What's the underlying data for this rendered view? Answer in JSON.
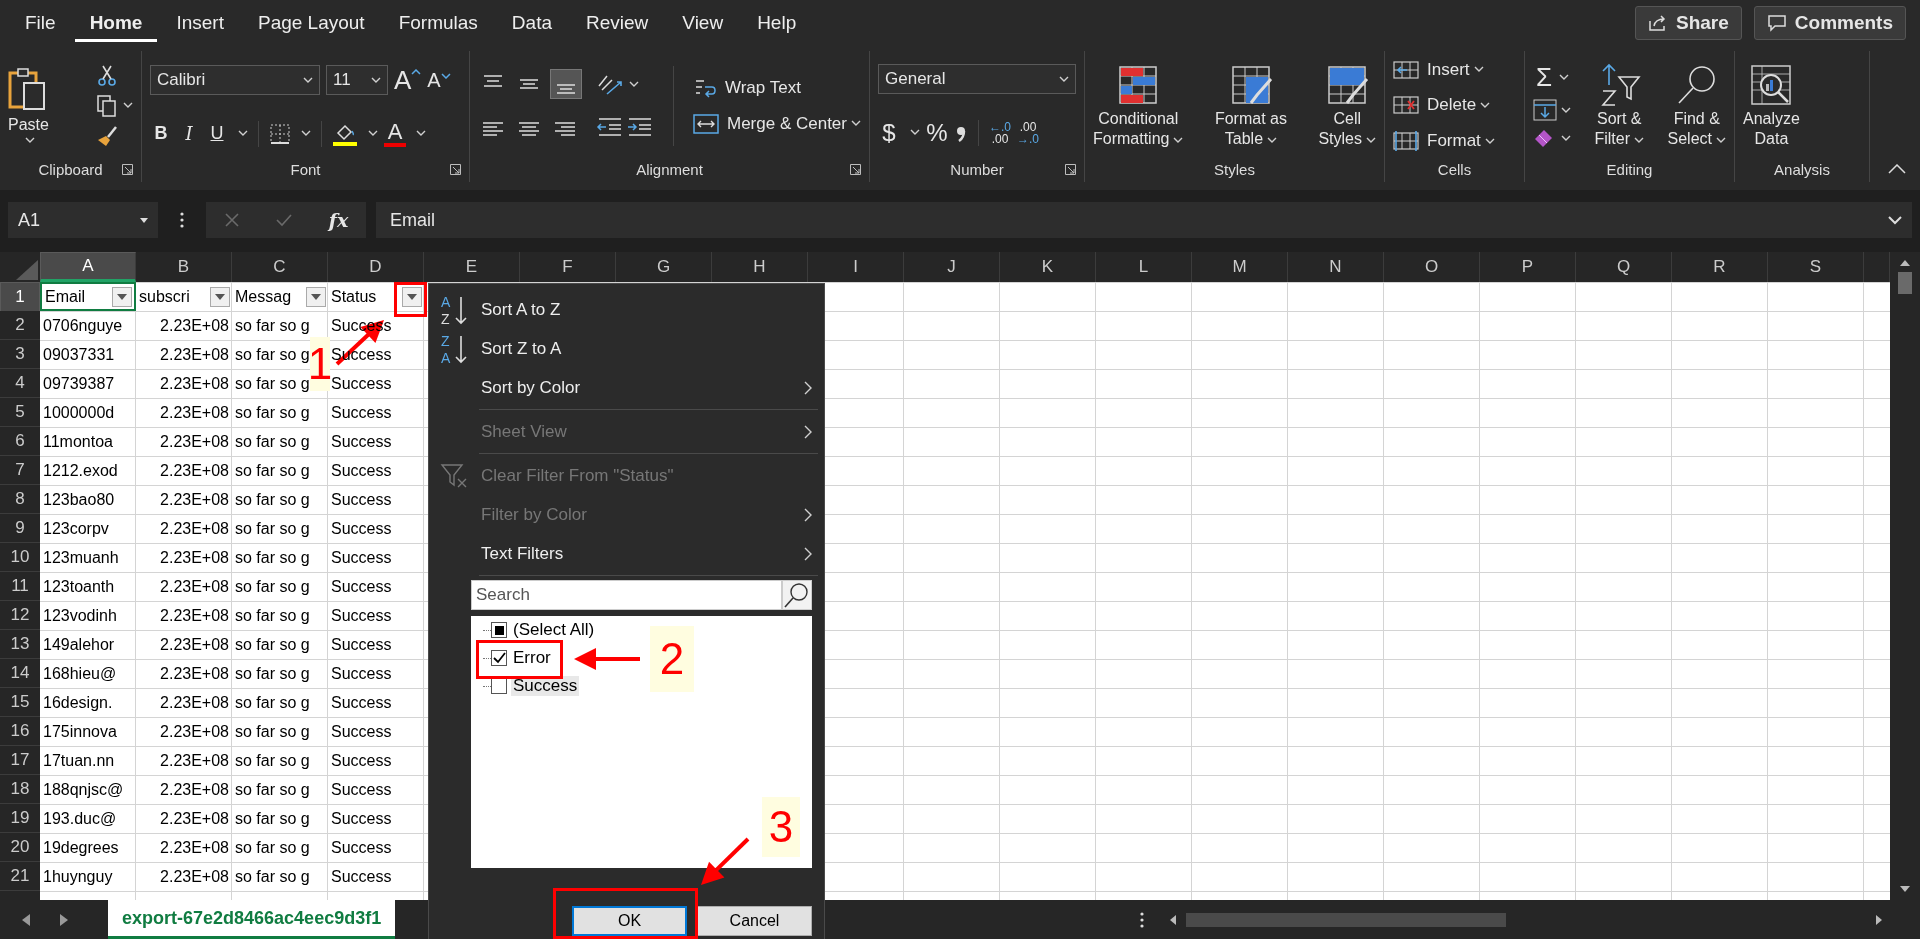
{
  "ribbon_tabs": [
    {
      "label": "File",
      "selected": false
    },
    {
      "label": "Home",
      "selected": true
    },
    {
      "label": "Insert",
      "selected": false
    },
    {
      "label": "Page Layout",
      "selected": false
    },
    {
      "label": "Formulas",
      "selected": false
    },
    {
      "label": "Data",
      "selected": false
    },
    {
      "label": "Review",
      "selected": false
    },
    {
      "label": "View",
      "selected": false
    },
    {
      "label": "Help",
      "selected": false
    }
  ],
  "share_button": "Share",
  "comments_button": "Comments",
  "clipboard": {
    "title": "Clipboard",
    "paste": "Paste"
  },
  "font": {
    "title": "Font",
    "name": "Calibri",
    "size": "11",
    "grow": "A",
    "shrink": "A",
    "bold": "B",
    "italic": "I",
    "underline": "U",
    "font_color_letter": "A"
  },
  "alignment": {
    "title": "Alignment",
    "wrap_text": "Wrap Text",
    "merge": "Merge & Center"
  },
  "number": {
    "title": "Number",
    "format": "General",
    "currency": "$",
    "percent": "%",
    "increase_decimal": [
      "←.0",
      ".00"
    ],
    "decrease_decimal": [
      ".00",
      "→.0"
    ]
  },
  "styles": {
    "title": "Styles",
    "buttons": [
      "Conditional\nFormatting",
      "Format as\nTable",
      "Cell\nStyles"
    ]
  },
  "cells": {
    "title": "Cells",
    "buttons": [
      "Insert",
      "Delete",
      "Format"
    ]
  },
  "editing": {
    "title": "Editing",
    "autosum": "Σ",
    "buttons": [
      "Sort &\nFilter",
      "Find &\nSelect"
    ]
  },
  "analysis": {
    "title": "Analysis",
    "button": "Analyze\nData"
  },
  "formula_bar": {
    "name_box": "A1",
    "fx": "fx",
    "formula": "Email"
  },
  "columns": [
    {
      "label": "A",
      "selected": true
    },
    {
      "label": "B",
      "selected": false
    },
    {
      "label": "C",
      "selected": false
    },
    {
      "label": "D",
      "selected": false
    },
    {
      "label": "E",
      "selected": false
    },
    {
      "label": "F",
      "selected": false
    },
    {
      "label": "G",
      "selected": false
    },
    {
      "label": "H",
      "selected": false
    },
    {
      "label": "I",
      "selected": false
    },
    {
      "label": "J",
      "selected": false
    },
    {
      "label": "K",
      "selected": false
    },
    {
      "label": "L",
      "selected": false
    },
    {
      "label": "M",
      "selected": false
    },
    {
      "label": "N",
      "selected": false
    },
    {
      "label": "O",
      "selected": false
    },
    {
      "label": "P",
      "selected": false
    },
    {
      "label": "Q",
      "selected": false
    },
    {
      "label": "R",
      "selected": false
    },
    {
      "label": "S",
      "selected": false
    }
  ],
  "header_row": {
    "number": "1",
    "selected": true,
    "cells": [
      "Email",
      "subscri",
      "Messag",
      "Status"
    ]
  },
  "rows": [
    {
      "number": "2",
      "cells": [
        "0706nguye",
        "2.23E+08",
        "so far so g",
        "Success"
      ]
    },
    {
      "number": "3",
      "cells": [
        "09037331",
        "2.23E+08",
        "so far so g",
        "Success"
      ]
    },
    {
      "number": "4",
      "cells": [
        "09739387",
        "2.23E+08",
        "so far so g",
        "Success"
      ]
    },
    {
      "number": "5",
      "cells": [
        "1000000d",
        "2.23E+08",
        "so far so g",
        "Success"
      ]
    },
    {
      "number": "6",
      "cells": [
        "11montoa",
        "2.23E+08",
        "so far so g",
        "Success"
      ]
    },
    {
      "number": "7",
      "cells": [
        "1212.exod",
        "2.23E+08",
        "so far so g",
        "Success"
      ]
    },
    {
      "number": "8",
      "cells": [
        "123bao80",
        "2.23E+08",
        "so far so g",
        "Success"
      ]
    },
    {
      "number": "9",
      "cells": [
        "123corpv",
        "2.23E+08",
        "so far so g",
        "Success"
      ]
    },
    {
      "number": "10",
      "cells": [
        "123muanh",
        "2.23E+08",
        "so far so g",
        "Success"
      ]
    },
    {
      "number": "11",
      "cells": [
        "123toanth",
        "2.23E+08",
        "so far so g",
        "Success"
      ]
    },
    {
      "number": "12",
      "cells": [
        "123vodinh",
        "2.23E+08",
        "so far so g",
        "Success"
      ]
    },
    {
      "number": "13",
      "cells": [
        "149alehor",
        "2.23E+08",
        "so far so g",
        "Success"
      ]
    },
    {
      "number": "14",
      "cells": [
        "168hieu@",
        "2.23E+08",
        "so far so g",
        "Success"
      ]
    },
    {
      "number": "15",
      "cells": [
        "16design.",
        "2.23E+08",
        "so far so g",
        "Success"
      ]
    },
    {
      "number": "16",
      "cells": [
        "175innova",
        "2.23E+08",
        "so far so g",
        "Success"
      ]
    },
    {
      "number": "17",
      "cells": [
        "17tuan.nn",
        "2.23E+08",
        "so far so g",
        "Success"
      ]
    },
    {
      "number": "18",
      "cells": [
        "188qnjsc@",
        "2.23E+08",
        "so far so g",
        "Success"
      ]
    },
    {
      "number": "19",
      "cells": [
        "193.duc@",
        "2.23E+08",
        "so far so g",
        "Success"
      ]
    },
    {
      "number": "20",
      "cells": [
        "19degrees",
        "2.23E+08",
        "so far so g",
        "Success"
      ]
    },
    {
      "number": "21",
      "cells": [
        "1huynguy",
        "2.23E+08",
        "so far so g",
        "Success"
      ]
    }
  ],
  "filter_menu": {
    "items": [
      {
        "kind": "sort",
        "icon_letters": [
          "A",
          "Z"
        ],
        "label": "Sort A to Z",
        "disabled": false
      },
      {
        "kind": "sort",
        "icon_letters": [
          "Z",
          "A"
        ],
        "label": "Sort Z to A",
        "disabled": false
      },
      {
        "kind": "submenu",
        "label": "Sort by Color",
        "disabled": false
      },
      {
        "kind": "separator"
      },
      {
        "kind": "submenu",
        "label": "Sheet View",
        "disabled": true
      },
      {
        "kind": "separator"
      },
      {
        "kind": "clear",
        "label": "Clear Filter From \"Status\"",
        "disabled": true
      },
      {
        "kind": "submenu",
        "label": "Filter by Color",
        "disabled": true
      },
      {
        "kind": "submenu",
        "label": "Text Filters",
        "disabled": false
      },
      {
        "kind": "separator"
      }
    ],
    "search": {
      "placeholder": "Search"
    },
    "values": [
      {
        "label": "(Select All)",
        "checked": false,
        "partial": true,
        "highlighted": false
      },
      {
        "label": "Error",
        "checked": true,
        "partial": false,
        "highlighted": false
      },
      {
        "label": "Success",
        "checked": false,
        "partial": false,
        "highlighted": true
      }
    ],
    "buttons": [
      {
        "label": "OK",
        "focused": true
      },
      {
        "label": "Cancel",
        "focused": false
      }
    ]
  },
  "sheet_tab": {
    "label": "export-67e2d8466ac4eec9d3f1",
    "selected": true
  },
  "annotations": [
    {
      "number": "1"
    },
    {
      "number": "2"
    },
    {
      "number": "3"
    }
  ]
}
